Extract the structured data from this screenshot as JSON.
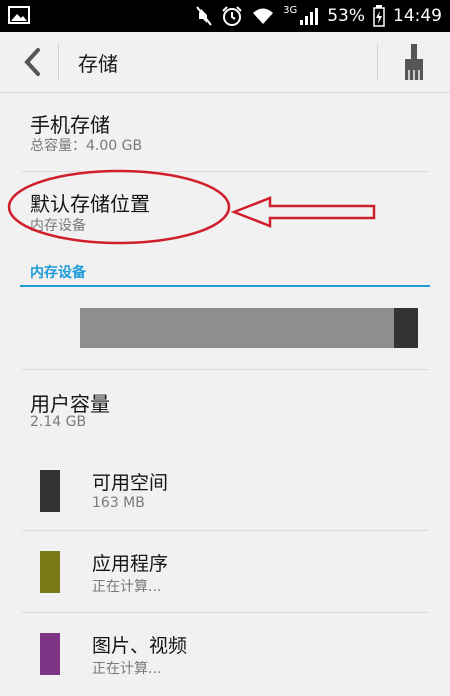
{
  "status_bar": {
    "network": "3G",
    "battery": "53%",
    "time": "14:49"
  },
  "action_bar": {
    "title": "存储"
  },
  "phone_storage": {
    "title": "手机存储",
    "subtitle": "总容量：4.00  GB"
  },
  "default_location": {
    "title": "默认存储位置",
    "subtitle": "内存设备"
  },
  "internal_header": "内存设备",
  "usage_bar": {
    "used_fraction": 0.07,
    "colors": {
      "track": "#8e8e8e",
      "fill": "#333333"
    }
  },
  "user_capacity": {
    "title": "用户容量",
    "subtitle": "2.14  GB"
  },
  "categories": [
    {
      "title": "可用空间",
      "value": "163  MB",
      "color": "#333333"
    },
    {
      "title": "应用程序",
      "value": "正在计算...",
      "color": "#7b7a18"
    },
    {
      "title": "图片、视频",
      "value": "正在计算...",
      "color": "#7d3585"
    }
  ],
  "annotation": {
    "color": "#d01f2a"
  }
}
